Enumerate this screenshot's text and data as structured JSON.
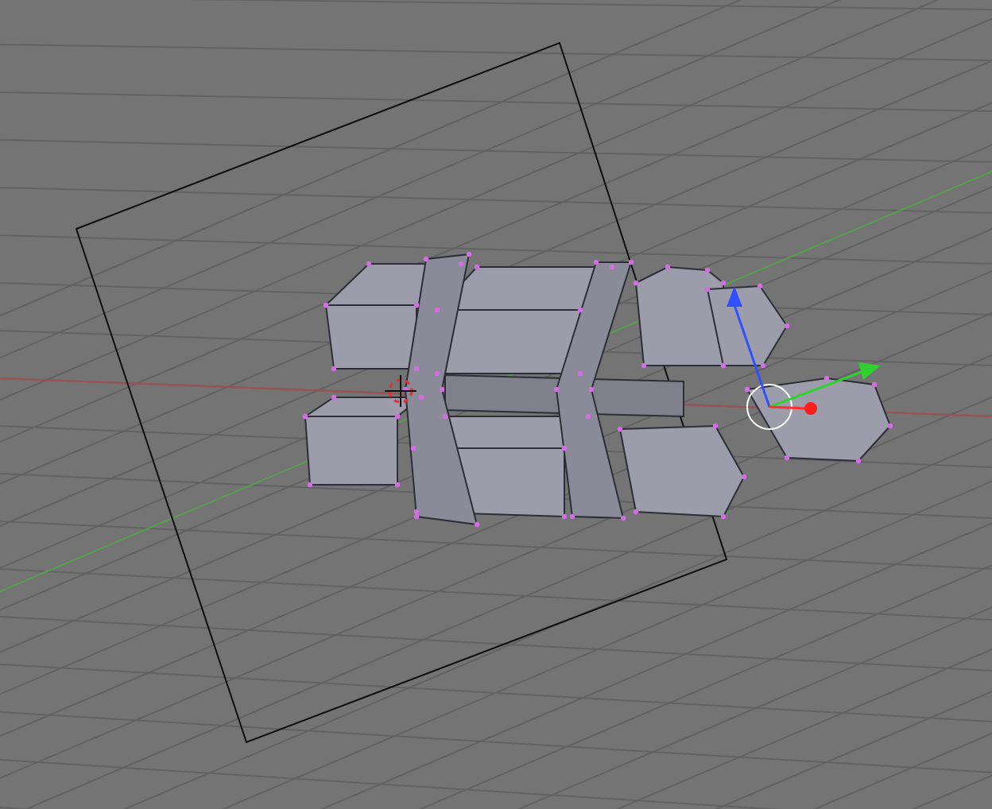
{
  "viewport": {
    "grid": true,
    "axes": true,
    "manipulator": true,
    "cursor_3d": true
  }
}
